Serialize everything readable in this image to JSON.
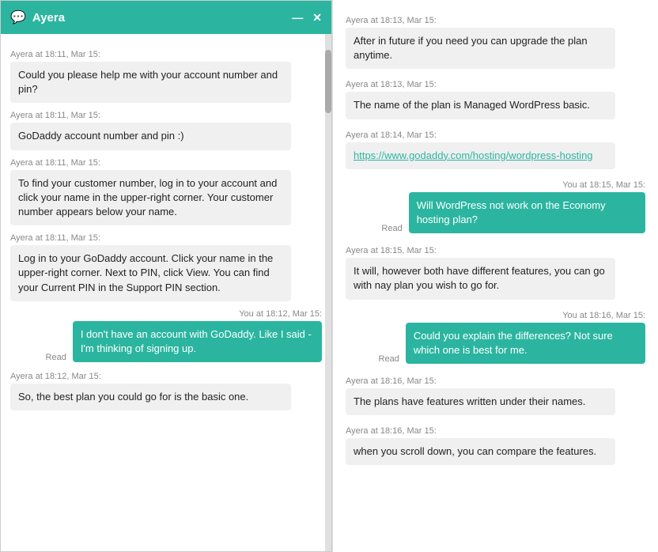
{
  "header": {
    "title": "Ayera",
    "icon": "💬",
    "minimize_label": "—",
    "close_label": "✕",
    "scroll_up_label": "▲"
  },
  "left_messages": [
    {
      "type": "timestamp",
      "text": "Ayera at 18:11, Mar 15:"
    },
    {
      "type": "agent",
      "text": "Could you please help me with your account number and pin?"
    },
    {
      "type": "timestamp",
      "text": "Ayera at 18:11, Mar 15:"
    },
    {
      "type": "agent",
      "text": "GoDaddy account number and pin :)"
    },
    {
      "type": "timestamp",
      "text": "Ayera at 18:11, Mar 15:"
    },
    {
      "type": "agent",
      "text": "To find your customer number, log in to your account and click your name in the upper-right corner. Your customer number appears below your name."
    },
    {
      "type": "timestamp",
      "text": "Ayera at 18:11, Mar 15:"
    },
    {
      "type": "agent",
      "text": "Log in to your GoDaddy account. Click your name in the upper-right corner. Next to PIN, click View. You can find your Current PIN in the Support PIN section."
    },
    {
      "type": "timestamp-right",
      "text": "You at 18:12, Mar 15:"
    },
    {
      "type": "user",
      "text": "I don't have an account with GoDaddy. Like I said - I'm thinking of signing up.",
      "read": true
    },
    {
      "type": "timestamp",
      "text": "Ayera at 18:12, Mar 15:"
    },
    {
      "type": "agent",
      "text": "So, the best plan you could go for is the basic one."
    }
  ],
  "right_messages": [
    {
      "type": "timestamp",
      "text": "Ayera at 18:13, Mar 15:"
    },
    {
      "type": "agent",
      "text": "After in future if you need you can upgrade the plan anytime."
    },
    {
      "type": "timestamp",
      "text": "Ayera at 18:13, Mar 15:"
    },
    {
      "type": "agent",
      "text": "The name of the plan is Managed WordPress basic."
    },
    {
      "type": "timestamp",
      "text": "Ayera at 18:14, Mar 15:"
    },
    {
      "type": "agent-link",
      "text": "https://www.godaddy.com/hosting/wordpress-hosting"
    },
    {
      "type": "timestamp-right",
      "text": "You at 18:15, Mar 15:"
    },
    {
      "type": "user",
      "text": "Will WordPress not work on the Economy hosting plan?",
      "read": true
    },
    {
      "type": "timestamp",
      "text": "Ayera at 18:15, Mar 15:"
    },
    {
      "type": "agent",
      "text": "It will, however both have different features, you can go with nay plan you wish to go for."
    },
    {
      "type": "timestamp-right",
      "text": "You at 18:16, Mar 15:"
    },
    {
      "type": "user",
      "text": "Could you explain the differences? Not sure which one is best for me.",
      "read": true
    },
    {
      "type": "timestamp",
      "text": "Ayera at 18:16, Mar 15:"
    },
    {
      "type": "agent",
      "text": "The plans have features written under their names."
    },
    {
      "type": "timestamp",
      "text": "Ayera at 18:16, Mar 15:"
    },
    {
      "type": "agent",
      "text": "when you scroll down, you can compare the features."
    }
  ]
}
